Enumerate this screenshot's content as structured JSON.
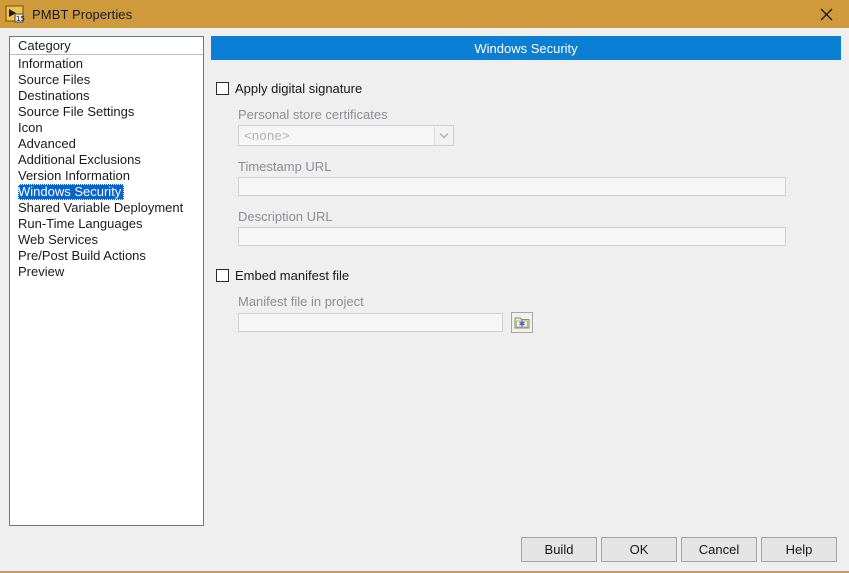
{
  "window": {
    "title": "PMBT Properties",
    "icon": "labview-project-icon",
    "icon_badge": "15",
    "close_label": "✕",
    "titlebar_color": "#cf9a3c",
    "accent_color": "#0a7fd4",
    "selection_color": "#0a63c9"
  },
  "sidebar": {
    "header": "Category",
    "selected": "Windows Security",
    "items": [
      {
        "label": "Information"
      },
      {
        "label": "Source Files"
      },
      {
        "label": "Destinations"
      },
      {
        "label": "Source File Settings"
      },
      {
        "label": "Icon"
      },
      {
        "label": "Advanced"
      },
      {
        "label": "Additional Exclusions"
      },
      {
        "label": "Version Information"
      },
      {
        "label": "Windows Security"
      },
      {
        "label": "Shared Variable Deployment"
      },
      {
        "label": "Run-Time Languages"
      },
      {
        "label": "Web Services"
      },
      {
        "label": "Pre/Post Build Actions"
      },
      {
        "label": "Preview"
      }
    ]
  },
  "panel": {
    "header": "Windows Security",
    "apply_signature": {
      "label": "Apply digital signature",
      "checked": false
    },
    "personal_store": {
      "label": "Personal store certificates",
      "value": "<none>",
      "enabled": false,
      "arrow": "chevron-down"
    },
    "timestamp_url": {
      "label": "Timestamp URL",
      "value": "",
      "enabled": false
    },
    "description_url": {
      "label": "Description URL",
      "value": "",
      "enabled": false
    },
    "embed_manifest": {
      "label": "Embed manifest file",
      "checked": false
    },
    "manifest_file": {
      "label": "Manifest file in project",
      "value": "",
      "enabled": false,
      "browse_icon": "folder-browse-icon"
    }
  },
  "footer": {
    "buttons": [
      {
        "label": "Build"
      },
      {
        "label": "OK"
      },
      {
        "label": "Cancel"
      },
      {
        "label": "Help"
      }
    ]
  }
}
